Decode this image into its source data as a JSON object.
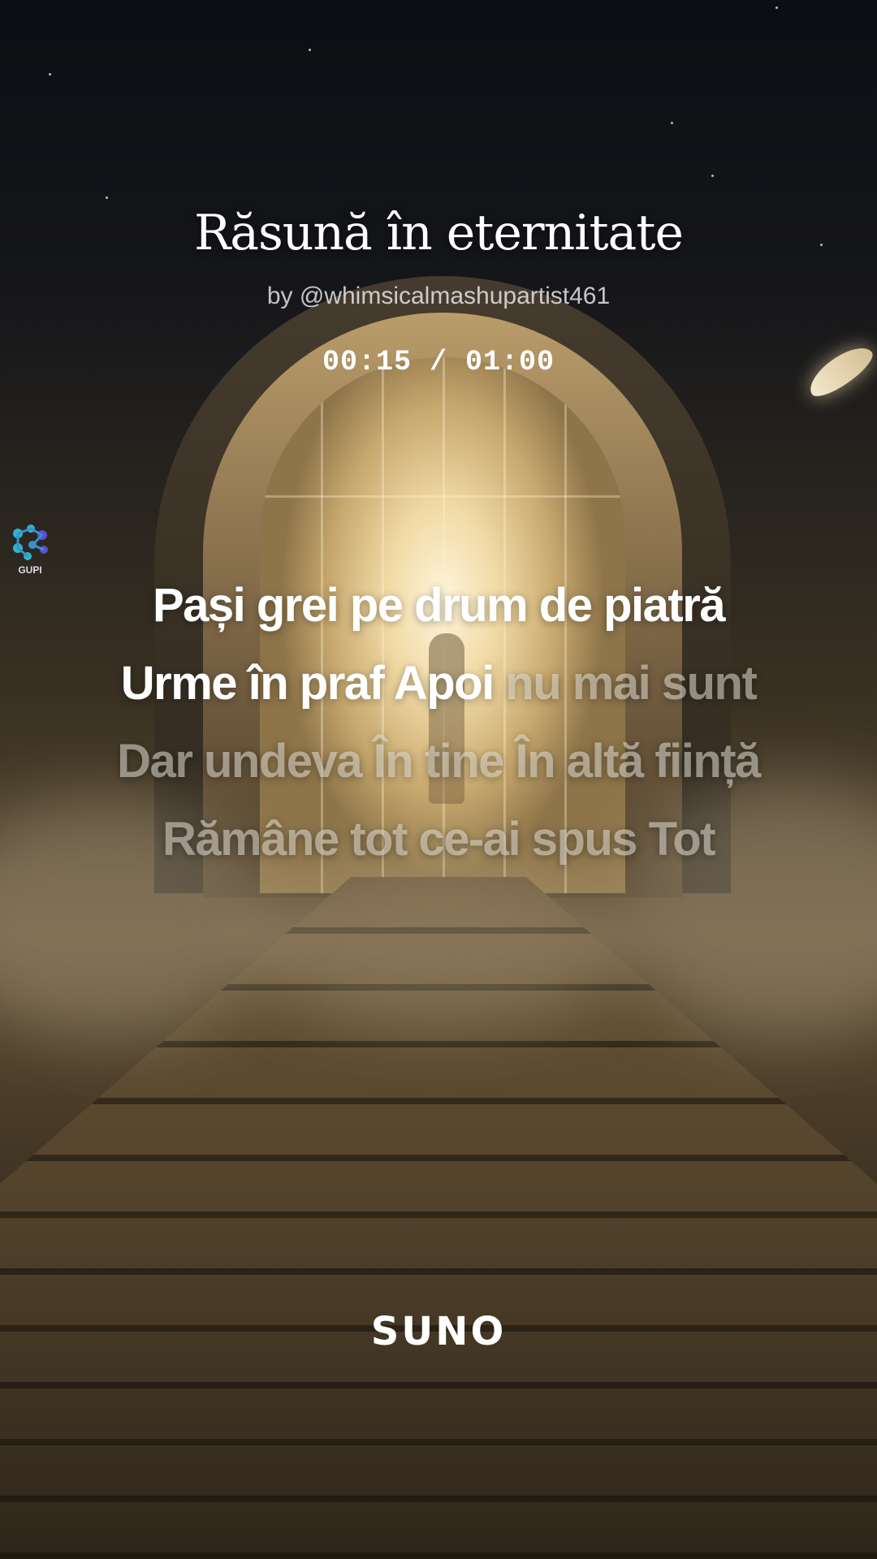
{
  "song": {
    "title": "Răsună în eternitate",
    "artist": "by @whimsicalmashupartist461",
    "time": "00:15 / 01:00",
    "progress_fraction": 0.25
  },
  "lyrics": {
    "line1": {
      "sung": "Pași grei pe drum de piatră",
      "unsung": ""
    },
    "line2": {
      "sung": "Urme în praf Apoi ",
      "unsung": "nu mai sunt"
    },
    "line3": {
      "sung": "",
      "unsung": "Dar undeva În tine În altă ființă"
    },
    "line4": {
      "sung": "",
      "unsung": "Rămâne tot ce-ai spus Tot"
    }
  },
  "watermark": {
    "label": "GUPI",
    "icon": "gupi-logo-icon"
  },
  "brand": {
    "label": "SUNO"
  },
  "colors": {
    "sung_text": "#ffffff",
    "unsung_text": "#c9c3b6",
    "gupi_teal": "#2bb7c9",
    "gupi_purple": "#5b4fcf"
  }
}
